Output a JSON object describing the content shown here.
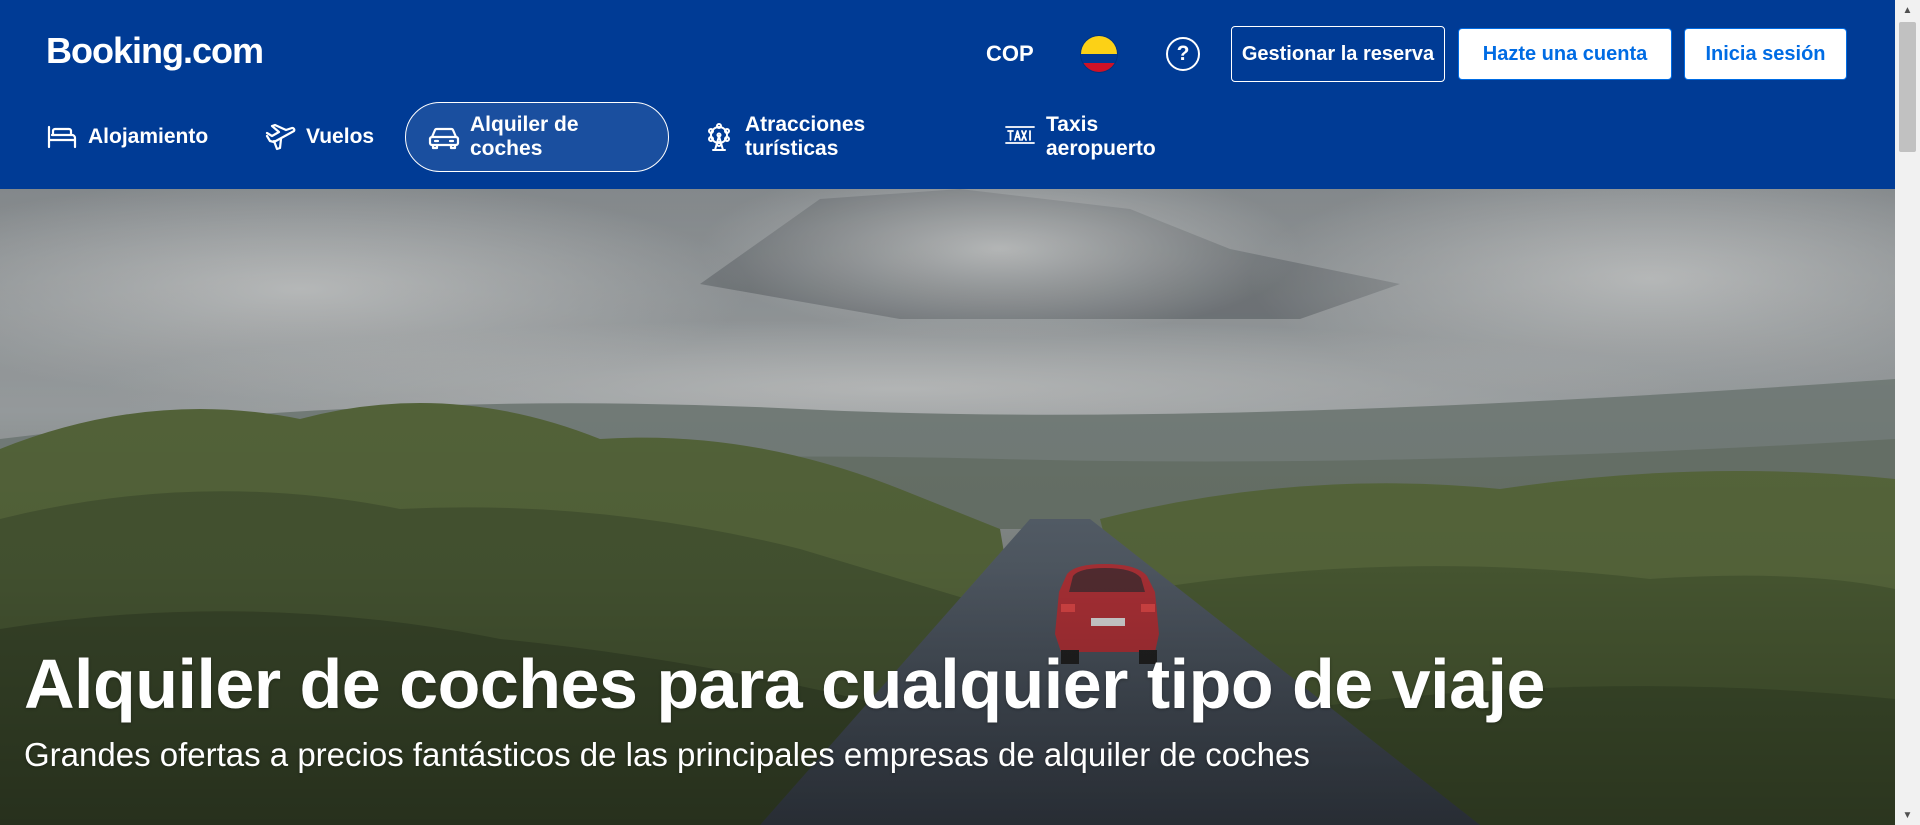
{
  "header": {
    "logo": "Booking.com",
    "currency": "COP",
    "flag_icon": "colombia-flag-icon",
    "help_icon": "question-circle-icon",
    "manage_booking": "Gestionar la reserva",
    "register": "Hazte una cuenta",
    "login": "Inicia sesión",
    "colors": {
      "brand_blue": "#003b95",
      "action_blue": "#006ce4"
    }
  },
  "nav": {
    "items": [
      {
        "label": "Alojamiento",
        "icon": "bed-icon",
        "active": false
      },
      {
        "label": "Vuelos",
        "icon": "plane-icon",
        "active": false
      },
      {
        "label": "Alquiler de coches",
        "icon": "car-icon",
        "active": true
      },
      {
        "label": "Atracciones turísticas",
        "icon": "ferris-wheel-icon",
        "active": false
      },
      {
        "label": "Taxis aeropuerto",
        "icon": "taxi-icon",
        "active": false
      }
    ]
  },
  "hero": {
    "title": "Alquiler de coches para cualquier tipo de viaje",
    "subtitle": "Grandes ofertas a precios fantásticos de las principales empresas de alquiler de coches",
    "image": "car-on-road-landscape"
  }
}
